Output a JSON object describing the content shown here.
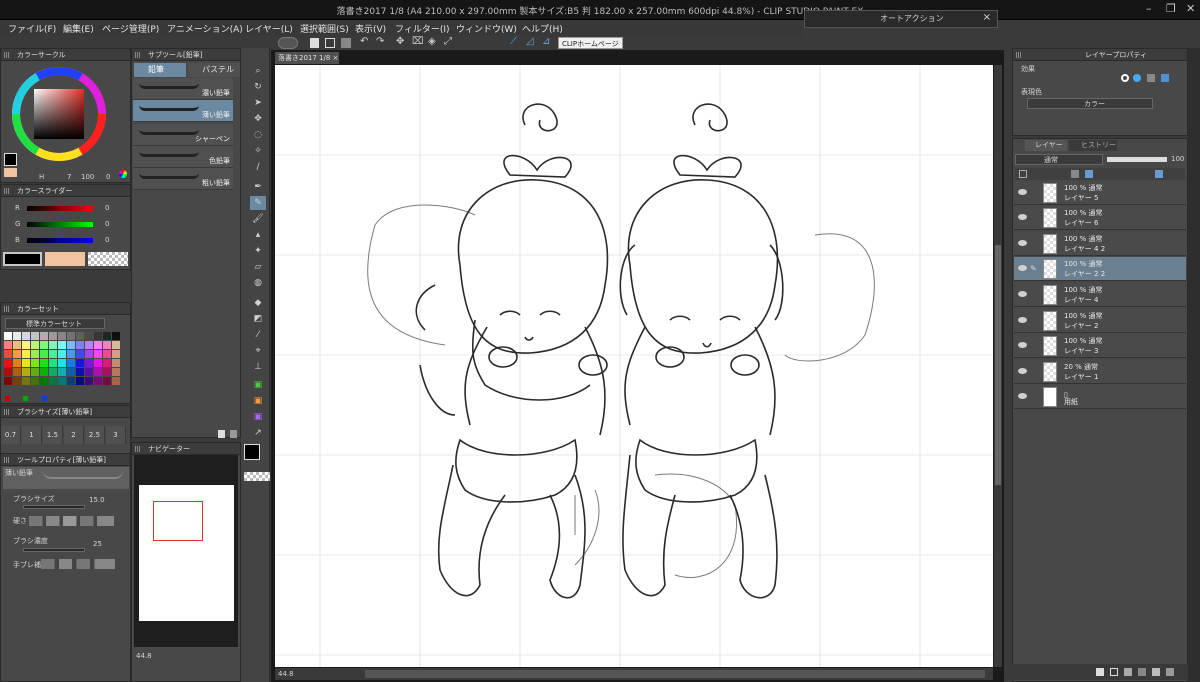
{
  "window": {
    "title": "落書き2017 1/8 (A4 210.00 x 297.00mm 製本サイズ:B5 判 182.00 x 257.00mm 600dpi 44.8%) - CLIP STUDIO PAINT EX"
  },
  "auto_action": {
    "title": "オートアクション",
    "close": "×"
  },
  "menu": [
    "ファイル(F)",
    "編集(E)",
    "ページ管理(P)",
    "アニメーション(A)",
    "レイヤー(L)",
    "選択範囲(S)",
    "表示(V)",
    "フィルター(I)",
    "ウィンドウ(W)",
    "ヘルプ(H)"
  ],
  "command_bar": {
    "home_button": "CLIPホームページ"
  },
  "color_circle": {
    "title": "カラーサークル",
    "h": "7",
    "s": "100",
    "v": "0"
  },
  "color_slider": {
    "title": "カラースライダー",
    "rows": [
      {
        "label": "R",
        "value": "0"
      },
      {
        "label": "G",
        "value": "0"
      },
      {
        "label": "B",
        "value": "0"
      }
    ]
  },
  "color_set": {
    "title": "カラーセット",
    "set_name": "標準カラーセット"
  },
  "brush_size": {
    "title": "ブラシサイズ[薄い鉛筆]",
    "sizes": [
      "0.7",
      "1",
      "1.5",
      "2",
      "2.5",
      "3"
    ]
  },
  "tool_property": {
    "title": "ツールプロパティ[薄い鉛筆]",
    "tool_name": "薄い鉛筆",
    "brush_size_label": "ブラシサイズ",
    "brush_size_value": "15.0",
    "hardness_label": "硬さ",
    "density_label": "ブラシ濃度",
    "density_value": "25",
    "stabilization_label": "手ブレ補正"
  },
  "sub_tool": {
    "title": "サブツール[鉛筆]",
    "tabs": [
      "鉛筆",
      "パステル"
    ],
    "items": [
      "濃い鉛筆",
      "薄い鉛筆",
      "シャーペン",
      "色鉛筆",
      "粗い鉛筆"
    ],
    "selected_index": 1
  },
  "navigator": {
    "title": "ナビゲーター",
    "zoom": "44.8"
  },
  "canvas": {
    "tab": "落書き2017 1/8",
    "zoom": "44.8"
  },
  "layer_property": {
    "title": "レイヤープロパティ",
    "effect_label": "効果",
    "expression_label": "表現色",
    "expression_value": "カラー"
  },
  "layer_panel": {
    "tabs": [
      "レイヤー",
      "ヒストリー"
    ],
    "blend_mode": "通常",
    "opacity": "100",
    "layers": [
      {
        "opacity": "100 %",
        "mode": "通常",
        "name": "レイヤー 5"
      },
      {
        "opacity": "100 %",
        "mode": "通常",
        "name": "レイヤー 6"
      },
      {
        "opacity": "100 %",
        "mode": "通常",
        "name": "レイヤー 4 2"
      },
      {
        "opacity": "100 %",
        "mode": "通常",
        "name": "レイヤー 2 2"
      },
      {
        "opacity": "100 %",
        "mode": "通常",
        "name": "レイヤー 4"
      },
      {
        "opacity": "100 %",
        "mode": "通常",
        "name": "レイヤー 2"
      },
      {
        "opacity": "100 %",
        "mode": "通常",
        "name": "レイヤー 3"
      },
      {
        "opacity": "20 %",
        "mode": "通常",
        "name": "レイヤー 1"
      },
      {
        "opacity": "",
        "mode": "",
        "name": "用紙"
      }
    ],
    "selected_index": 3
  },
  "colors": {
    "accent": "#6b8aa1",
    "main_color": "#000000",
    "sub_color": "#f2c3a0",
    "panel_bg": "#484848",
    "titlebar": "#151515"
  }
}
